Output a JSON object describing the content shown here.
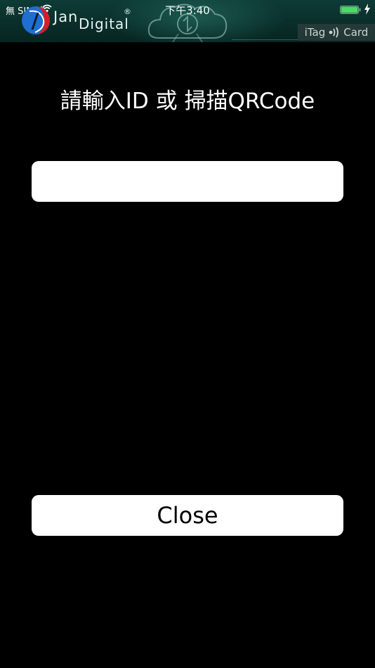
{
  "status_bar": {
    "carrier": "無 SIM 卡",
    "time": "下午3:40"
  },
  "header": {
    "brand_jan": "Jan",
    "brand_digital": "Digital",
    "brand_reg": "®",
    "badge_left": "iTag",
    "badge_right": "Card"
  },
  "main": {
    "prompt": "請輸入ID 或 掃描QRCode",
    "id_input": {
      "value": "",
      "placeholder": ""
    },
    "close_label": "Close"
  },
  "colors": {
    "background": "#000000",
    "header_teal": "#0a2e2a",
    "battery_green": "#4cd964",
    "logo_red": "#d0202a",
    "logo_blue": "#1e6fd0",
    "button_bg": "#ffffff"
  },
  "icons": {
    "wifi": "wifi-icon",
    "battery": "battery-icon",
    "charge": "charge-bolt-icon",
    "logo": "jan-digital-logo-icon",
    "cloud": "cloud-sync-icon",
    "nfc": "nfc-signal-icon"
  }
}
